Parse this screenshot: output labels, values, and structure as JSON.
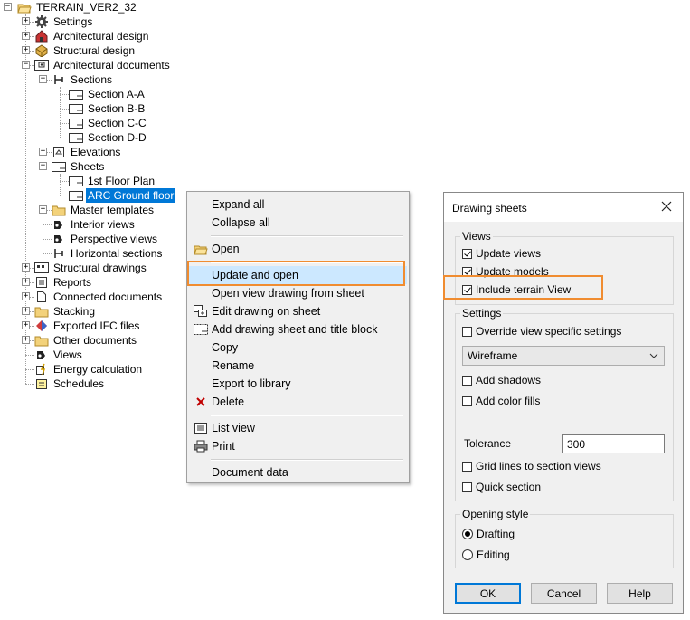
{
  "tree": {
    "root": "TERRAIN_VER2_32",
    "items": {
      "settings": "Settings",
      "architectural_design": "Architectural design",
      "structural_design": "Structural design",
      "architectural_documents": "Architectural documents",
      "sections": "Sections",
      "section_a": "Section A-A",
      "section_b": "Section B-B",
      "section_c": "Section C-C",
      "section_d": "Section D-D",
      "elevations": "Elevations",
      "sheets": "Sheets",
      "first_floor_plan": "1st Floor Plan",
      "arc_ground_floor": "ARC Ground floor",
      "master_templates": "Master templates",
      "interior_views": "Interior views",
      "perspective_views": "Perspective views",
      "horizontal_sections": "Horizontal sections",
      "structural_drawings": "Structural drawings",
      "reports": "Reports",
      "connected_documents": "Connected documents",
      "stacking": "Stacking",
      "exported_ifc_files": "Exported IFC files",
      "other_documents": "Other documents",
      "views": "Views",
      "energy_calculation": "Energy calculation",
      "schedules": "Schedules"
    },
    "selected": "ARC Ground floor"
  },
  "context_menu": {
    "expand_all": "Expand all",
    "collapse_all": "Collapse all",
    "open": "Open",
    "update_and_open": "Update and open",
    "open_view_drawing": "Open view drawing from sheet",
    "edit_drawing": "Edit drawing on sheet",
    "add_drawing_sheet": "Add drawing sheet and title block",
    "copy": "Copy",
    "rename": "Rename",
    "export_to_library": "Export to library",
    "delete": "Delete",
    "list_view": "List view",
    "print": "Print",
    "document_data": "Document data",
    "highlighted": "Update and open"
  },
  "dialog": {
    "title": "Drawing sheets",
    "views_group": "Views",
    "update_views": "Update views",
    "update_views_checked": true,
    "update_models": "Update models",
    "update_models_checked": true,
    "include_terrain": "Include terrain View",
    "include_terrain_checked": true,
    "settings_group": "Settings",
    "override": "Override view specific settings",
    "render_mode": "Wireframe",
    "add_shadows": "Add shadows",
    "add_color_fills": "Add color fills",
    "tolerance_label": "Tolerance",
    "tolerance_value": "300",
    "grid_lines": "Grid lines to section views",
    "quick_section": "Quick section",
    "opening_style_group": "Opening style",
    "drafting": "Drafting",
    "editing": "Editing",
    "opening_style_selected": "Drafting",
    "ok": "OK",
    "cancel": "Cancel",
    "help": "Help"
  },
  "colors": {
    "highlight_border": "#f08c30",
    "selection": "#0078d7",
    "menu_hover": "#cce8ff"
  }
}
